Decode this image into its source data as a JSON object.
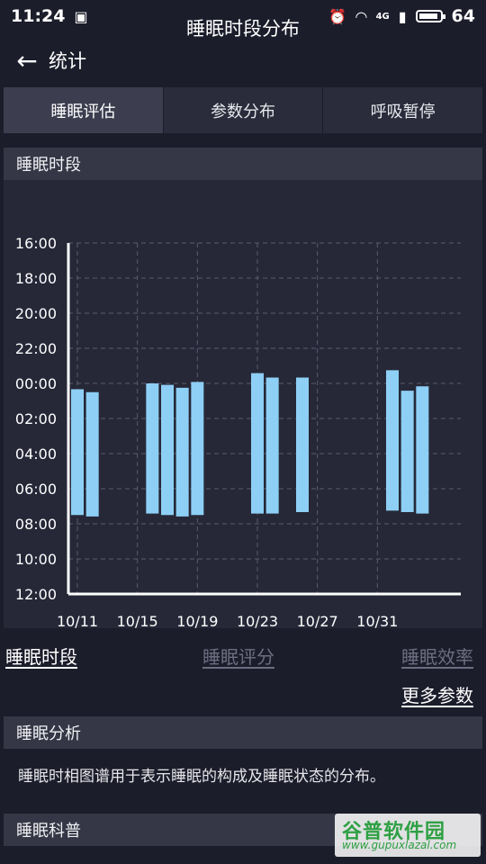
{
  "status_bar": {
    "time": "11:24",
    "battery": "64",
    "network": "4G",
    "icons": [
      "image-icon",
      "alarm-icon",
      "wifi-icon",
      "signal-icon",
      "battery-icon"
    ]
  },
  "header": {
    "title": "统计",
    "back_icon": "arrow-left-icon"
  },
  "tabs": [
    {
      "label": "睡眠评估",
      "active": true
    },
    {
      "label": "参数分布",
      "active": false
    },
    {
      "label": "呼吸暂停",
      "active": false
    }
  ],
  "sections": {
    "sleep_period": "睡眠时段",
    "sleep_analysis": "睡眠分析",
    "sleep_science": "睡眠科普"
  },
  "chart_data": {
    "type": "bar",
    "title": "睡眠时段分布",
    "bar_color": "#8ecff5",
    "grid": true,
    "y_tick_labels": [
      "16:00",
      "18:00",
      "20:00",
      "22:00",
      "00:00",
      "02:00",
      "04:00",
      "06:00",
      "08:00",
      "10:00",
      "12:00"
    ],
    "y_range_hours_since_16": [
      0,
      20
    ],
    "x_tick_labels": [
      "10/11",
      "10/15",
      "10/19",
      "10/23",
      "10/27",
      "10/31"
    ],
    "series": [
      {
        "points": [
          {
            "date": "10/11",
            "start": "00:20",
            "end": "07:30"
          },
          {
            "date": "10/12",
            "start": "00:30",
            "end": "07:35"
          },
          {
            "date": "10/16",
            "start": "00:00",
            "end": "07:25"
          },
          {
            "date": "10/17",
            "start": "00:05",
            "end": "07:30"
          },
          {
            "date": "10/18",
            "start": "00:15",
            "end": "07:35"
          },
          {
            "date": "10/19",
            "start": "23:55",
            "end": "07:30"
          },
          {
            "date": "10/23",
            "start": "23:25",
            "end": "07:25"
          },
          {
            "date": "10/24",
            "start": "23:40",
            "end": "07:25"
          },
          {
            "date": "10/26",
            "start": "23:40",
            "end": "07:20"
          },
          {
            "date": "11/01",
            "start": "23:15",
            "end": "07:15"
          },
          {
            "date": "11/02",
            "start": "00:25",
            "end": "07:20"
          },
          {
            "date": "11/03",
            "start": "00:10",
            "end": "07:25"
          }
        ]
      }
    ]
  },
  "links": {
    "sleep_period": "睡眠时段",
    "sleep_score": "睡眠评分",
    "sleep_efficiency": "睡眠效率",
    "more_params": "更多参数"
  },
  "analysis_text": "睡眠时相图谱用于表示睡眠的构成及睡眠状态的分布。",
  "watermark": {
    "title": "谷普软件园",
    "url": "www.gupuxlazal.com"
  }
}
